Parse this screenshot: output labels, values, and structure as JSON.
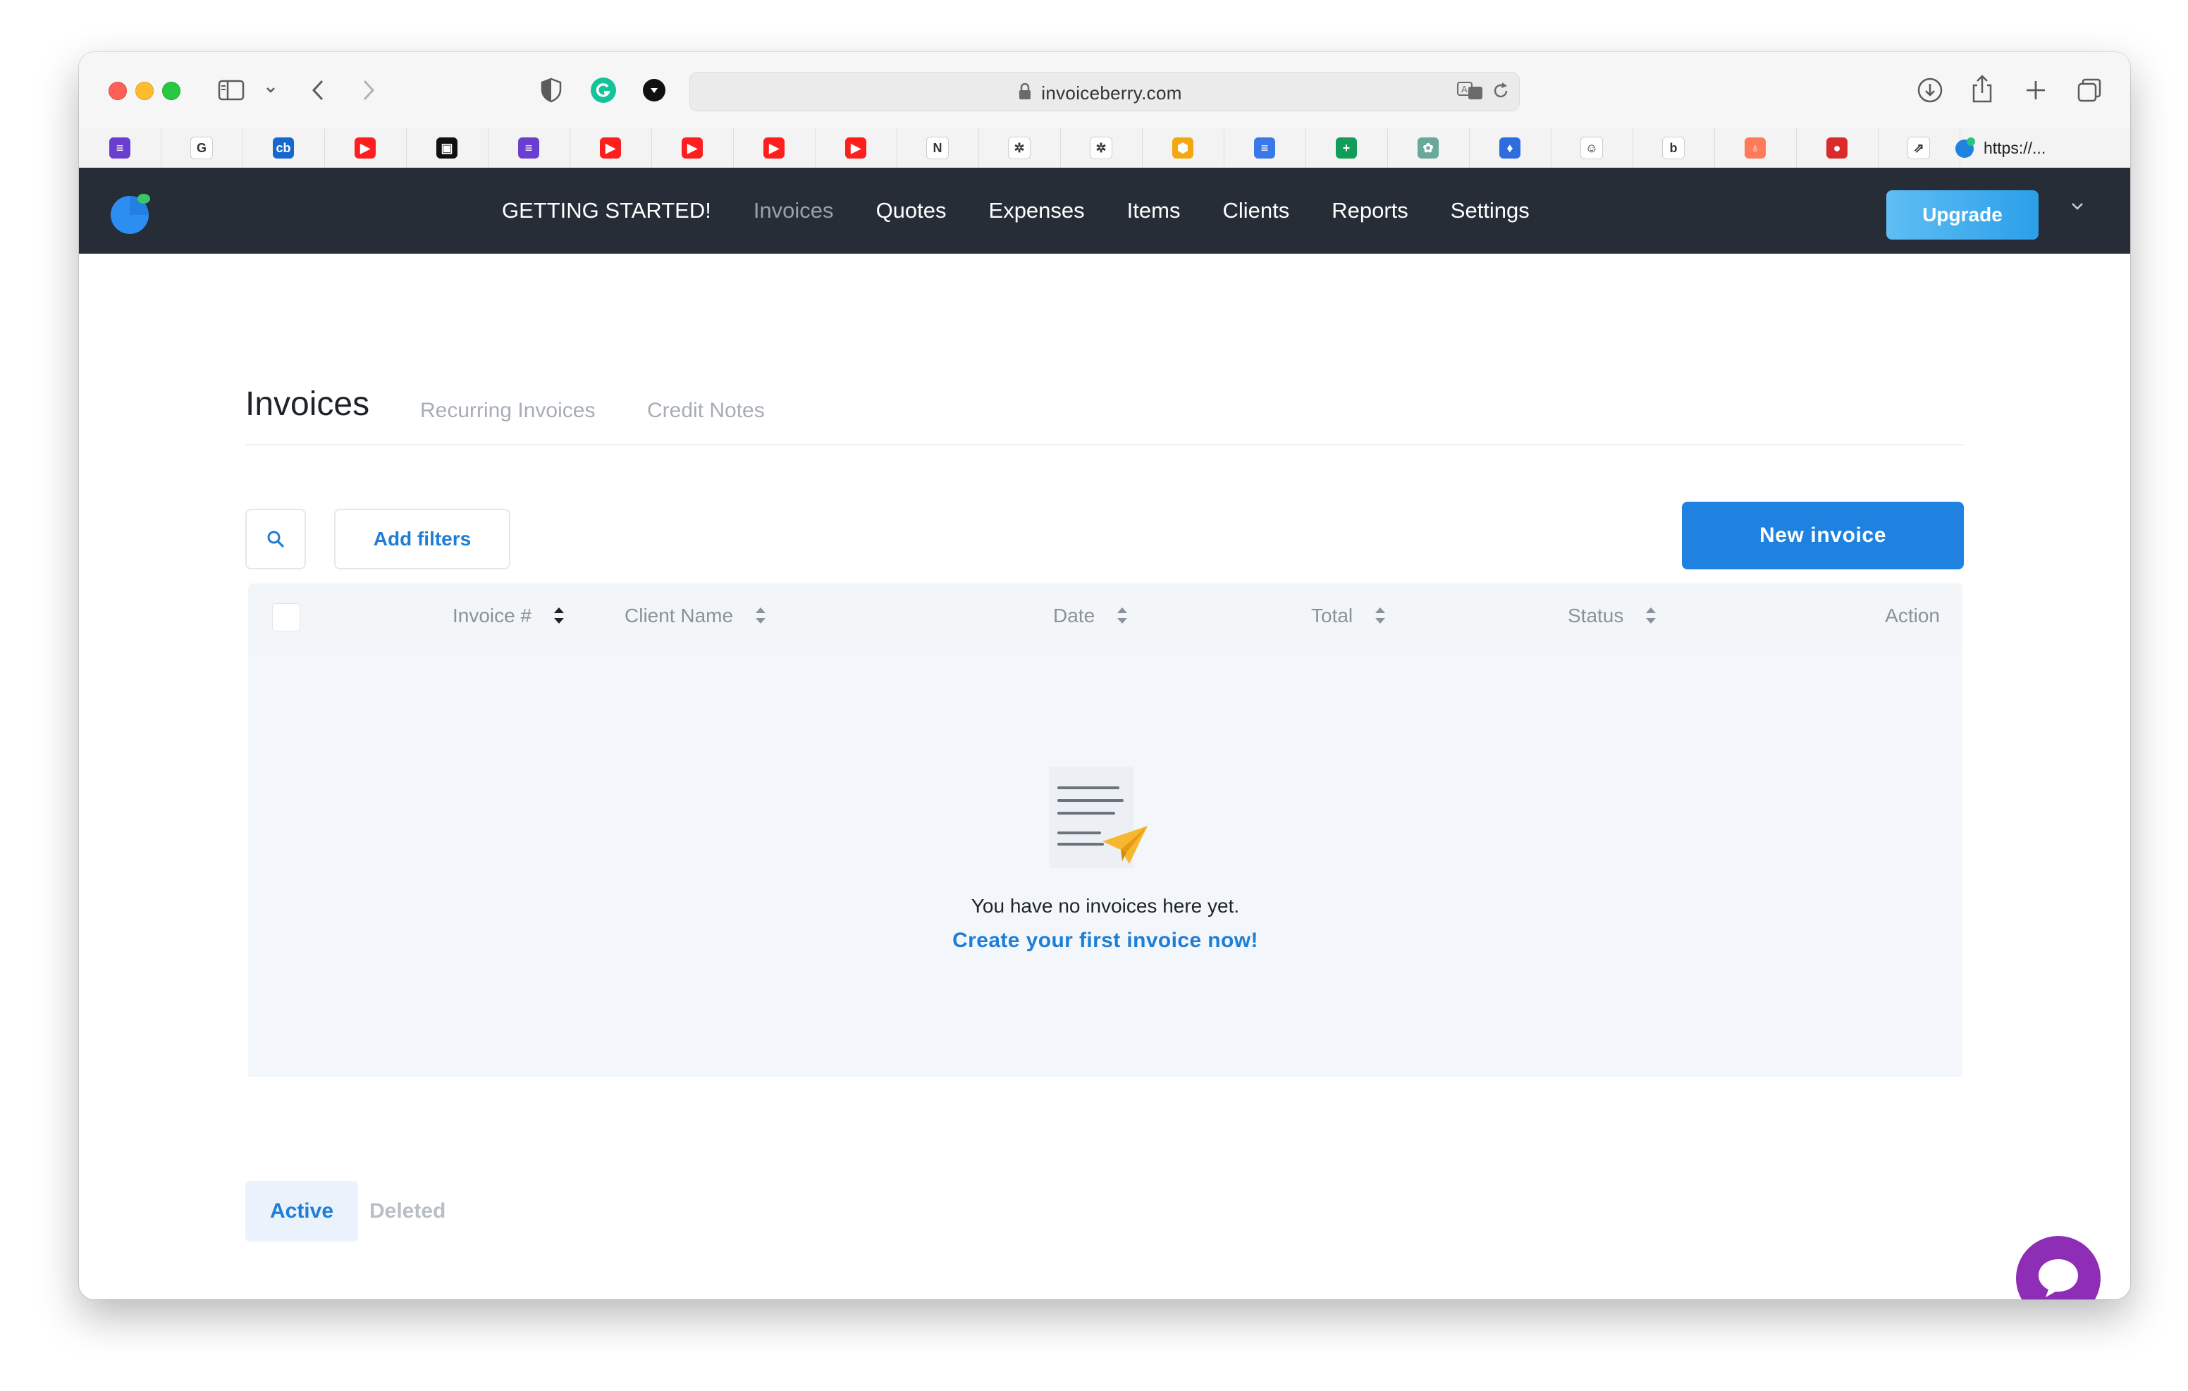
{
  "browser": {
    "url": "invoiceberry.com",
    "last_bookmark_label": "https://..."
  },
  "bookmarks": [
    {
      "icon": "list-icon",
      "color": "#6a3fd0",
      "glyph": "≡"
    },
    {
      "icon": "google-icon",
      "color": "#ffffff",
      "glyph": "G"
    },
    {
      "icon": "crunchbase-icon",
      "color": "#1668cf",
      "glyph": "cb"
    },
    {
      "icon": "youtube-icon",
      "color": "#ff1e1e",
      "glyph": "▶"
    },
    {
      "icon": "video-icon",
      "color": "#111111",
      "glyph": "▣"
    },
    {
      "icon": "list-icon",
      "color": "#6a3fd0",
      "glyph": "≡"
    },
    {
      "icon": "youtube-icon",
      "color": "#ff1e1e",
      "glyph": "▶"
    },
    {
      "icon": "youtube-icon",
      "color": "#ff1e1e",
      "glyph": "▶"
    },
    {
      "icon": "youtube-icon",
      "color": "#ff1e1e",
      "glyph": "▶"
    },
    {
      "icon": "youtube-icon",
      "color": "#ff1e1e",
      "glyph": "▶"
    },
    {
      "icon": "notion-icon",
      "color": "#ffffff",
      "glyph": "N"
    },
    {
      "icon": "tableau-icon",
      "color": "#ffffff",
      "glyph": "✲"
    },
    {
      "icon": "tableau-icon",
      "color": "#ffffff",
      "glyph": "✲"
    },
    {
      "icon": "hexagon-icon",
      "color": "#f3a712",
      "glyph": "⬢"
    },
    {
      "icon": "docs-icon",
      "color": "#3b78e7",
      "glyph": "≡"
    },
    {
      "icon": "sheets-icon",
      "color": "#0f9d58",
      "glyph": "+"
    },
    {
      "icon": "chatgpt-icon",
      "color": "#6aa89a",
      "glyph": "✿"
    },
    {
      "icon": "shield-icon",
      "color": "#2d6de0",
      "glyph": "♦"
    },
    {
      "icon": "robot-icon",
      "color": "#ffffff",
      "glyph": "☺"
    },
    {
      "icon": "b-icon",
      "color": "#ffffff",
      "glyph": "b"
    },
    {
      "icon": "hubspot-icon",
      "color": "#ff7a59",
      "glyph": "♁"
    },
    {
      "icon": "red-circle-icon",
      "color": "#d92b2b",
      "glyph": "●"
    },
    {
      "icon": "jira-icon",
      "color": "#ffffff",
      "glyph": "⇗"
    }
  ],
  "nav": {
    "items": [
      {
        "label": "GETTING STARTED!",
        "active": false
      },
      {
        "label": "Invoices",
        "active": true
      },
      {
        "label": "Quotes",
        "active": false
      },
      {
        "label": "Expenses",
        "active": false
      },
      {
        "label": "Items",
        "active": false
      },
      {
        "label": "Clients",
        "active": false
      },
      {
        "label": "Reports",
        "active": false
      },
      {
        "label": "Settings",
        "active": false
      }
    ],
    "upgrade_label": "Upgrade"
  },
  "page": {
    "title": "Invoices",
    "tabs": [
      "Recurring Invoices",
      "Credit Notes"
    ],
    "add_filters_label": "Add filters",
    "new_invoice_label": "New invoice"
  },
  "table": {
    "columns": [
      "Invoice #",
      "Client Name",
      "Date",
      "Total",
      "Status",
      "Action"
    ]
  },
  "empty_state": {
    "message": "You have no invoices here yet.",
    "cta": "Create your first invoice now!"
  },
  "footer_tabs": {
    "active_label": "Active",
    "deleted_label": "Deleted"
  },
  "colors": {
    "nav_bg": "#262d36",
    "accent_blue": "#1f82e0",
    "chat_purple": "#8e2db5"
  }
}
